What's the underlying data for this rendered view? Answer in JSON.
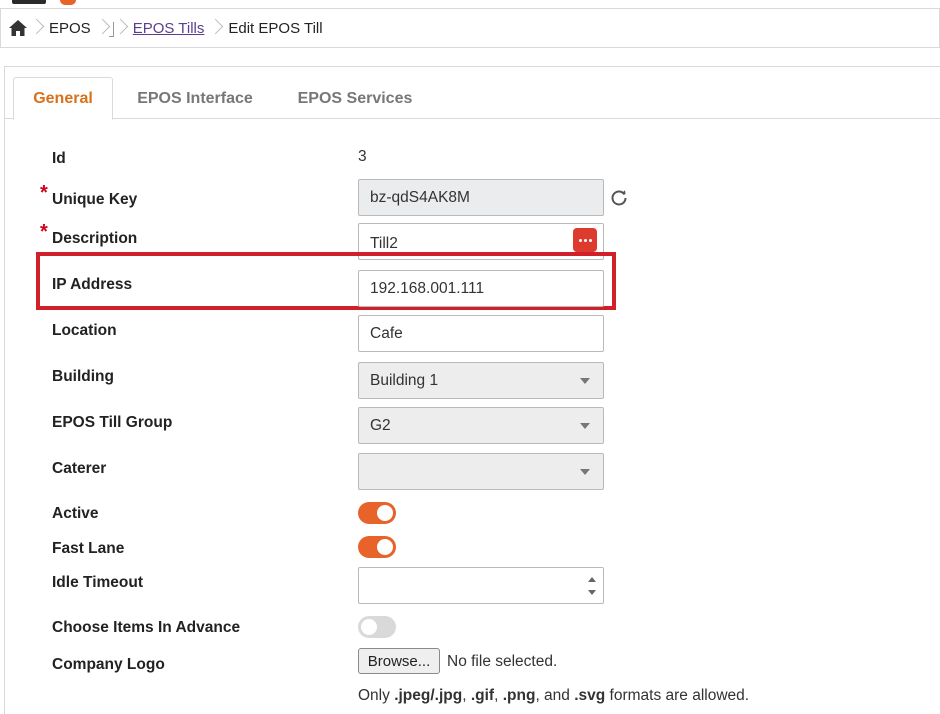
{
  "breadcrumb": {
    "items": [
      "EPOS",
      "EPOS Tills",
      "Edit EPOS Till"
    ]
  },
  "tabs": [
    {
      "label": "General",
      "active": true
    },
    {
      "label": "EPOS Interface",
      "active": false
    },
    {
      "label": "EPOS Services",
      "active": false
    }
  ],
  "form": {
    "id": {
      "label": "Id",
      "value": "3"
    },
    "unique_key": {
      "label": "Unique Key",
      "value": "bz-qdS4AK8M",
      "required": true
    },
    "description": {
      "label": "Description",
      "value": "Till2",
      "required": true
    },
    "ip_address": {
      "label": "IP Address",
      "value": "192.168.001.111"
    },
    "location": {
      "label": "Location",
      "value": "Cafe"
    },
    "building": {
      "label": "Building",
      "value": "Building 1"
    },
    "till_group": {
      "label": "EPOS Till Group",
      "value": "G2"
    },
    "caterer": {
      "label": "Caterer",
      "value": ""
    },
    "active": {
      "label": "Active",
      "on": true
    },
    "fast_lane": {
      "label": "Fast Lane",
      "on": true
    },
    "idle_timeout": {
      "label": "Idle Timeout",
      "value": ""
    },
    "choose_items": {
      "label": "Choose Items In Advance",
      "on": false
    },
    "company_logo": {
      "label": "Company Logo",
      "browse_label": "Browse...",
      "file_status": "No file selected.",
      "help_prefix": "Only ",
      "fmt1": ".jpeg/.jpg",
      "sep1": ", ",
      "fmt2": ".gif",
      "sep2": ", ",
      "fmt3": ".png",
      "sep3": ", and ",
      "fmt4": ".svg",
      "help_suffix": " formats are allowed."
    }
  },
  "colors": {
    "accent": "#e8632a",
    "tab_active": "#d8711c",
    "required": "#d0021b",
    "highlight": "#d0202a",
    "link": "#5a3f8c"
  }
}
